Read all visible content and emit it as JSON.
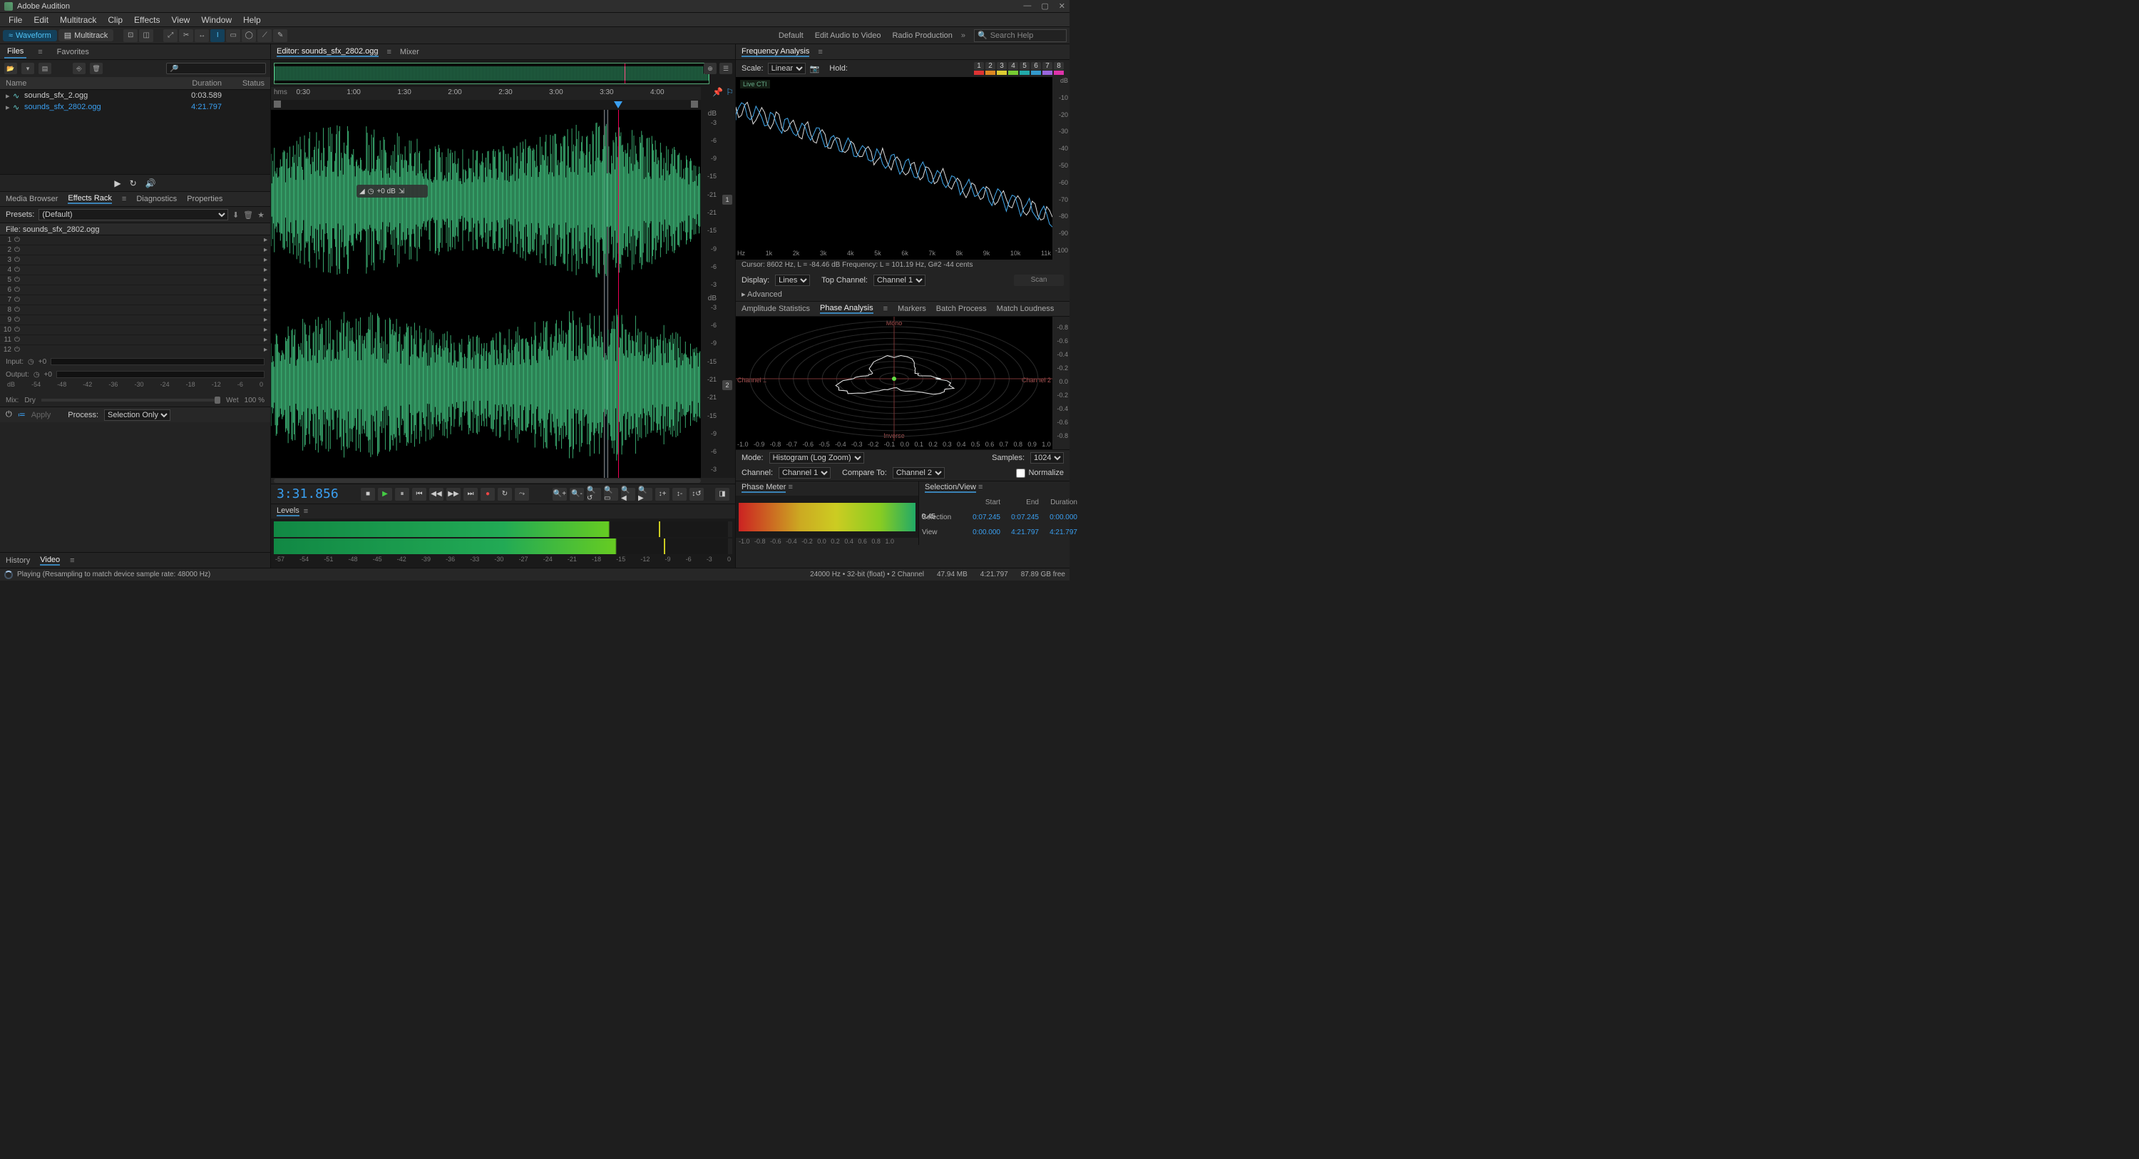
{
  "app": {
    "title": "Adobe Audition"
  },
  "menu": [
    "File",
    "Edit",
    "Multitrack",
    "Clip",
    "Effects",
    "View",
    "Window",
    "Help"
  ],
  "toolbar": {
    "mode_waveform": "Waveform",
    "mode_multitrack": "Multitrack"
  },
  "workspaces": [
    "Default",
    "Edit Audio to Video",
    "Radio Production"
  ],
  "search_placeholder": "Search Help",
  "files_panel": {
    "tabs": [
      "Files",
      "Favorites"
    ],
    "active_tab": "Files",
    "columns": {
      "name": "Name",
      "duration": "Duration",
      "status": "Status"
    },
    "rows": [
      {
        "name": "sounds_sfx_2.ogg",
        "duration": "0:03.589",
        "selected": false
      },
      {
        "name": "sounds_sfx_2802.ogg",
        "duration": "4:21.797",
        "selected": true
      }
    ]
  },
  "mid_panel": {
    "tabs": [
      "Media Browser",
      "Effects Rack",
      "Diagnostics",
      "Properties"
    ],
    "active_tab": "Effects Rack",
    "presets_label": "Presets:",
    "preset_value": "(Default)",
    "file_label": "File: sounds_sfx_2802.ogg",
    "slot_count": 12,
    "io": {
      "input": "Input:",
      "output": "Output:",
      "input_val": "+0",
      "output_val": "+0",
      "scale": [
        "dB",
        "-54",
        "-48",
        "-42",
        "-36",
        "-30",
        "-24",
        "-18",
        "-12",
        "-6",
        "0"
      ]
    },
    "mix": {
      "mix": "Mix:",
      "dry": "Dry",
      "wet": "Wet",
      "pct": "100 %"
    },
    "apply": {
      "apply": "Apply",
      "process_label": "Process:",
      "process_value": "Selection Only"
    }
  },
  "history_tabs": {
    "tabs": [
      "History",
      "Video"
    ],
    "active": "Video"
  },
  "editor": {
    "tabs": [
      "Editor: sounds_sfx_2802.ogg",
      "Mixer"
    ],
    "active_tab": "Editor: sounds_sfx_2802.ogg",
    "timeline": {
      "unit": "hms",
      "ticks": [
        "0:30",
        "1:00",
        "1:30",
        "2:00",
        "2:30",
        "3:00",
        "3:30",
        "4:00"
      ]
    },
    "db_ruler_label": "dB",
    "db_ticks": [
      "-3",
      "-6",
      "-9",
      "-15",
      "-21",
      "-21",
      "-15",
      "-9",
      "-6",
      "-3"
    ],
    "hud_gain": "+0 dB",
    "playhead_pct": 80.7,
    "selection": {
      "start_pct": 77.5,
      "width_pct": 0.3
    }
  },
  "transport": {
    "timecode": "3:31.856"
  },
  "levels": {
    "title": "Levels",
    "db_ticks": [
      "-57",
      "-54",
      "-51",
      "-48",
      "-45",
      "-42",
      "-39",
      "-36",
      "-33",
      "-30",
      "-27",
      "-24",
      "-21",
      "-18",
      "-15",
      "-12",
      "-9",
      "-6",
      "-3",
      "0"
    ]
  },
  "freq": {
    "tab": "Frequency Analysis",
    "scale_label": "Scale:",
    "scale_value": "Linear",
    "hold_label": "Hold:",
    "hold_buttons": [
      "1",
      "2",
      "3",
      "4",
      "5",
      "6",
      "7",
      "8"
    ],
    "hold_colors": [
      "#d33",
      "#d82",
      "#dc3",
      "#7c3",
      "#2aa",
      "#39c",
      "#96d",
      "#d3a"
    ],
    "y_ticks": [
      "dB",
      "-10",
      "-20",
      "-30",
      "-40",
      "-50",
      "-60",
      "-70",
      "-80",
      "-90",
      "-100"
    ],
    "x_ticks": [
      "Hz",
      "1k",
      "2k",
      "3k",
      "4k",
      "5k",
      "6k",
      "7k",
      "8k",
      "9k",
      "10k",
      "11k"
    ],
    "live_cti": "Live CTI",
    "cursor_text": "Cursor: 8602 Hz, L = -84.46 dB    Frequency: L = 101.19 Hz, G#2 -44 cents",
    "display_label": "Display:",
    "display_value": "Lines",
    "top_channel_label": "Top Channel:",
    "top_channel_value": "Channel 1",
    "scan": "Scan",
    "advanced": "Advanced"
  },
  "analysis_tabs": {
    "tabs": [
      "Amplitude Statistics",
      "Phase Analysis",
      "Markers",
      "Batch Process",
      "Match Loudness"
    ],
    "active": "Phase Analysis"
  },
  "phase": {
    "labels": {
      "mono": "Mono",
      "inverse": "Inverse",
      "ch1": "Channel 1",
      "ch2": "Channel 2"
    },
    "y_ticks": [
      "-0.8",
      "-0.6",
      "-0.4",
      "-0.2",
      "0.0",
      "-0.2",
      "-0.4",
      "-0.6",
      "-0.8"
    ],
    "x_ticks": [
      "-1.0",
      "-0.9",
      "-0.8",
      "-0.7",
      "-0.6",
      "-0.5",
      "-0.4",
      "-0.3",
      "-0.2",
      "-0.1",
      "0.0",
      "0.1",
      "0.2",
      "0.3",
      "0.4",
      "0.5",
      "0.6",
      "0.7",
      "0.8",
      "0.9",
      "1.0"
    ],
    "mode_label": "Mode:",
    "mode_value": "Histogram (Log Zoom)",
    "samples_label": "Samples:",
    "samples_value": "1024",
    "channel_label": "Channel:",
    "channel_value": "Channel 1",
    "compare_label": "Compare To:",
    "compare_value": "Channel 2",
    "normalize": "Normalize"
  },
  "phase_meter": {
    "title": "Phase Meter",
    "value": "0.45",
    "scale": [
      "-1.0",
      "-0.8",
      "-0.6",
      "-0.4",
      "-0.2",
      "0.0",
      "0.2",
      "0.4",
      "0.6",
      "0.8",
      "1.0"
    ]
  },
  "sel_view": {
    "title": "Selection/View",
    "cols": [
      "Start",
      "End",
      "Duration"
    ],
    "rows": [
      {
        "label": "Selection",
        "start": "0:07.245",
        "end": "0:07.245",
        "dur": "0:00.000"
      },
      {
        "label": "View",
        "start": "0:00.000",
        "end": "4:21.797",
        "dur": "4:21.797"
      }
    ]
  },
  "status": {
    "task": "Playing (Resampling to match device sample rate: 48000 Hz)",
    "right": [
      "24000 Hz • 32-bit (float) • 2 Channel",
      "47.94 MB",
      "4:21.797",
      "87.89 GB free"
    ]
  }
}
